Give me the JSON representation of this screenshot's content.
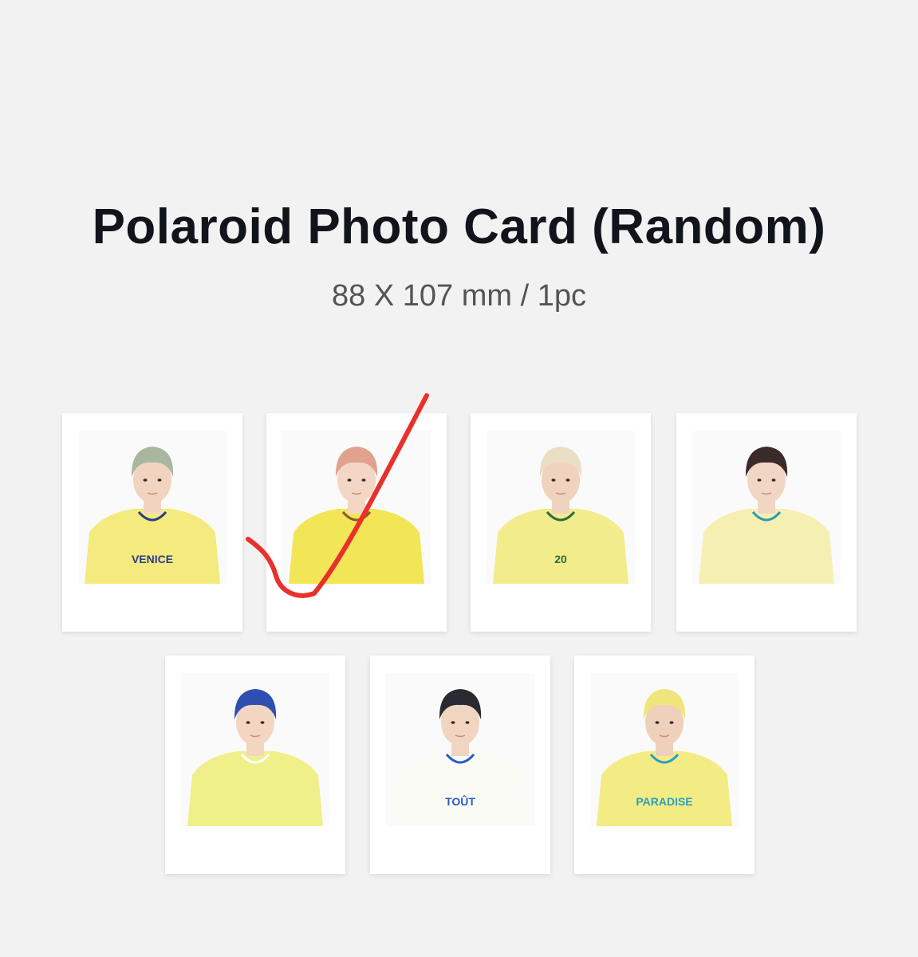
{
  "title": "Polaroid Photo Card (Random)",
  "subtitle": "88 X 107 mm / 1pc",
  "cards": [
    {
      "label": "member photo card 1",
      "hair": "#a9b79f",
      "shirt": "#f4ea7d",
      "skin": "#f1d4c0",
      "shirt_text": "VENICE",
      "accent": "#2a3b8f"
    },
    {
      "label": "member photo card 2",
      "hair": "#e0a28e",
      "shirt": "#f2e556",
      "skin": "#f3d7c4",
      "shirt_text": "",
      "accent": "#8b5a2b"
    },
    {
      "label": "member photo card 3",
      "hair": "#e8dfc4",
      "shirt": "#f3ec8c",
      "skin": "#f0d3bf",
      "shirt_text": "20",
      "accent": "#2f6b3a"
    },
    {
      "label": "member photo card 4",
      "hair": "#3b2a2a",
      "shirt": "#f6efb2",
      "skin": "#f1d6c3",
      "shirt_text": "",
      "accent": "#2a9bb0"
    },
    {
      "label": "member photo card 5",
      "hair": "#2e4fb0",
      "shirt": "#eff08a",
      "skin": "#f2d6c2",
      "shirt_text": "",
      "accent": "#ffffff"
    },
    {
      "label": "member photo card 6",
      "hair": "#2a2a33",
      "shirt": "#fbfbf6",
      "skin": "#f1d5c1",
      "shirt_text": "TOÛT",
      "accent": "#2a5cc8"
    },
    {
      "label": "member photo card 7",
      "hair": "#efe57a",
      "shirt": "#f3ec84",
      "skin": "#efd0ba",
      "shirt_text": "PARADISE",
      "accent": "#2aa0c0"
    }
  ],
  "annotation": {
    "type": "hand-drawn check mark",
    "color": "#e8312a"
  }
}
